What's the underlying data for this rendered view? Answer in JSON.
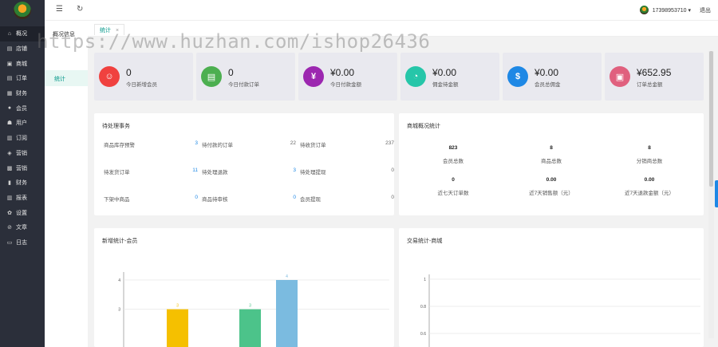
{
  "nav": [
    {
      "icon": "home-icon",
      "glyph": "⌂",
      "label": "概况"
    },
    {
      "icon": "tag-icon",
      "glyph": "▤",
      "label": "店铺"
    },
    {
      "icon": "shop-icon",
      "glyph": "▣",
      "label": "商城"
    },
    {
      "icon": "order-icon",
      "glyph": "▤",
      "label": "订单"
    },
    {
      "icon": "finance-icon",
      "glyph": "▦",
      "label": "财务"
    },
    {
      "icon": "member-icon",
      "glyph": "●",
      "label": "会员"
    },
    {
      "icon": "user-icon",
      "glyph": "☗",
      "label": "用户"
    },
    {
      "icon": "list-icon",
      "glyph": "▥",
      "label": "订阅"
    },
    {
      "icon": "cube-icon",
      "glyph": "◈",
      "label": "营销"
    },
    {
      "icon": "gift-icon",
      "glyph": "▩",
      "label": "营销"
    },
    {
      "icon": "chart-icon",
      "glyph": "▮",
      "label": "财务"
    },
    {
      "icon": "report-icon",
      "glyph": "▥",
      "label": "报表"
    },
    {
      "icon": "settings-icon",
      "glyph": "✿",
      "label": "设置"
    },
    {
      "icon": "article-icon",
      "glyph": "⊘",
      "label": "文章"
    },
    {
      "icon": "log-icon",
      "glyph": "▭",
      "label": "日志"
    }
  ],
  "subnav": {
    "title": "概况信息",
    "item": "统计"
  },
  "topbar": {
    "menu_icon": "☰",
    "refresh_icon": "↻",
    "username": "17398953710 ▾",
    "logout": "退出"
  },
  "tab": {
    "label": "统计",
    "close": "×"
  },
  "watermark": "https://www.huzhan.com/ishop26436",
  "stats": [
    {
      "value": "0",
      "label": "今日新增会员",
      "color": "#f0413f",
      "glyph": "☺"
    },
    {
      "value": "0",
      "label": "今日付款订单",
      "color": "#4caf50",
      "glyph": "▤"
    },
    {
      "value": "¥0.00",
      "label": "今日付款金额",
      "color": "#9c27b0",
      "glyph": "¥"
    },
    {
      "value": "¥0.00",
      "label": "佣金待金额",
      "color": "#26c6a9",
      "glyph": "◔"
    },
    {
      "value": "¥0.00",
      "label": "会员总佣金",
      "color": "#1e88e5",
      "glyph": "$"
    },
    {
      "value": "¥652.95",
      "label": "订单总金额",
      "color": "#e0607e",
      "glyph": "▣"
    }
  ],
  "todo": {
    "title": "待处理事务",
    "items": [
      {
        "label": "商品库存预警",
        "value": "3",
        "blue": true
      },
      {
        "label": "待付款的订单",
        "value": "22",
        "blue": false
      },
      {
        "label": "待收货订单",
        "value": "237",
        "blue": false
      },
      {
        "label": "待发货订单",
        "value": "11",
        "blue": true
      },
      {
        "label": "待处理退款",
        "value": "3",
        "blue": true
      },
      {
        "label": "待处理提现",
        "value": "0",
        "blue": false
      },
      {
        "label": "下架中商品",
        "value": "0",
        "blue": true
      },
      {
        "label": "商品待审核",
        "value": "0",
        "blue": true
      },
      {
        "label": "会员提现",
        "value": "0",
        "blue": false
      }
    ]
  },
  "mall": {
    "title": "商城概况统计",
    "cells": [
      {
        "value": "823",
        "label": "会员总数"
      },
      {
        "value": "8",
        "label": "商品总数"
      },
      {
        "value": "8",
        "label": "分销商总数"
      },
      {
        "value": "0",
        "label": "近七天订单数"
      },
      {
        "value": "0.00",
        "label": "近7天销售额（元）"
      },
      {
        "value": "0.00",
        "label": "近7天退款金额（元）"
      }
    ]
  },
  "chart_left": {
    "title": "新增统计-会员"
  },
  "chart_right": {
    "title": "交易统计-商城"
  },
  "chart_data": [
    {
      "type": "bar",
      "title": "新增统计-会员",
      "ylim": [
        1,
        4
      ],
      "ticks": [
        4,
        3
      ],
      "series": [
        {
          "value": 3,
          "color": "#f5c000"
        },
        {
          "value": 3,
          "color": "#4cc38a"
        },
        {
          "value": 4,
          "color": "#7bbbe0"
        }
      ]
    },
    {
      "type": "line",
      "title": "交易统计-商城",
      "ylim": [
        0.6,
        1
      ],
      "ticks": [
        "1",
        "0.8",
        "0.6"
      ],
      "series": []
    }
  ]
}
